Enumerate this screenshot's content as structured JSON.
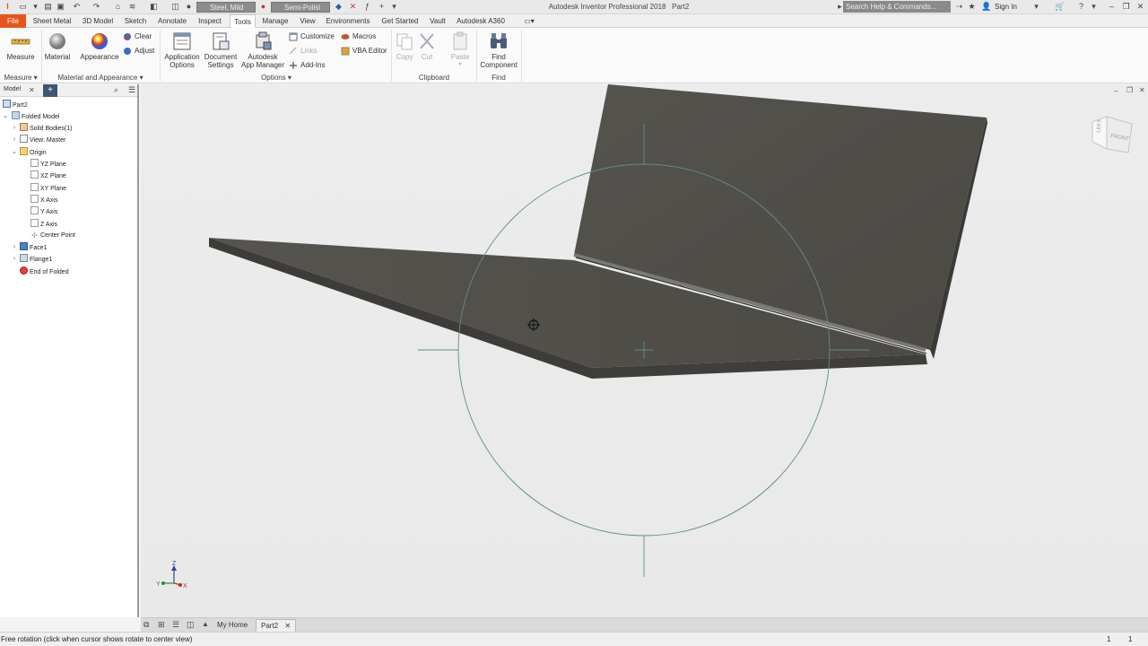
{
  "app": {
    "title": "Autodesk Inventor Professional 2018",
    "document_name": "Part2",
    "material_select": "Steel, Mild",
    "appearance_select": "Semi-Polisl",
    "search_placeholder": "Search Help & Commands...",
    "sign_in": "Sign In"
  },
  "menu": {
    "tabs": [
      "File",
      "Sheet Metal",
      "3D Model",
      "Sketch",
      "Annotate",
      "Inspect",
      "Tools",
      "Manage",
      "View",
      "Environments",
      "Get Started",
      "Vault",
      "Autodesk A360"
    ],
    "active_tab": "Tools"
  },
  "ribbon": {
    "measure": "Measure",
    "material": "Material",
    "appearance": "Appearance",
    "clear": "Clear",
    "adjust": "Adjust",
    "application_options": [
      "Application",
      "Options"
    ],
    "document_settings": [
      "Document",
      "Settings"
    ],
    "app_manager": [
      "Autodesk",
      "App Manager"
    ],
    "customize": "Customize",
    "links": "Links",
    "addins": "Add-Ins",
    "macros": "Macros",
    "vba_editor": "VBA Editor",
    "copy": "Copy",
    "cut": "Cut",
    "paste": "Paste",
    "find_component": [
      "Find",
      "Component"
    ],
    "panels": {
      "measure": "Measure",
      "material_appearance": "Material and Appearance",
      "options": "Options",
      "clipboard": "Clipboard",
      "find": "Find"
    }
  },
  "browser": {
    "tab": "Model",
    "root": "Part2",
    "items": [
      {
        "label": "Folded Model"
      },
      {
        "label": "Solid Bodies(1)"
      },
      {
        "label": "View: Master"
      },
      {
        "label": "Origin"
      },
      {
        "label": "YZ Plane"
      },
      {
        "label": "XZ Plane"
      },
      {
        "label": "XY Plane"
      },
      {
        "label": "X Axis"
      },
      {
        "label": "Y Axis"
      },
      {
        "label": "Z Axis"
      },
      {
        "label": "Center Point"
      },
      {
        "label": "Face1"
      },
      {
        "label": "Flange1"
      },
      {
        "label": "End of Folded"
      }
    ]
  },
  "viewport": {
    "viewcube_faces": [
      "LEFT",
      "FRONT"
    ],
    "triad": {
      "z": "Z",
      "y": "Y",
      "x": "X"
    }
  },
  "doc_tabs": {
    "home": "My Home",
    "active": "Part2"
  },
  "status": {
    "message": "Free rotation (click when cursor shows rotate to center view)",
    "count1": "1",
    "count2": "1"
  },
  "colors": {
    "file_tab": "#e7551b",
    "part_surface": "#4f4d48",
    "orbit_circle": "#5e8c8c"
  }
}
